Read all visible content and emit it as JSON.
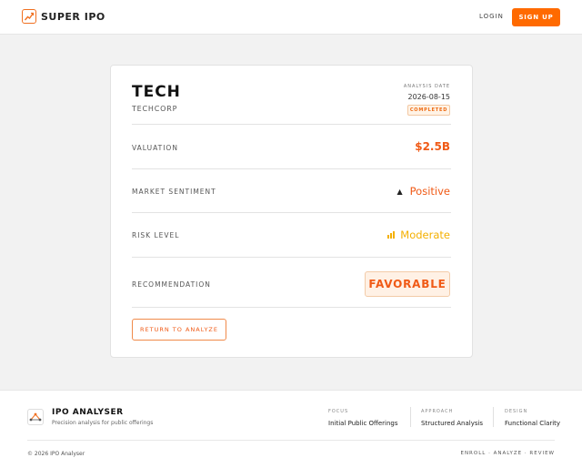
{
  "header": {
    "brand": "SUPER IPO",
    "login_label": "LOGIN",
    "signup_label": "SIGN UP"
  },
  "analysis": {
    "company": "TECH",
    "company_sub": "TECHCORP",
    "date_label": "ANALYSIS DATE",
    "date_value": "2026-08-15",
    "status": "COMPLETED",
    "rows": {
      "valuation": {
        "label": "VALUATION",
        "value": "$2.5B"
      },
      "sentiment": {
        "label": "MARKET SENTIMENT",
        "value": "Positive",
        "icon": "triangle-up-icon"
      },
      "risk": {
        "label": "RISK LEVEL",
        "value": "Moderate",
        "icon": "signal-bars-icon"
      },
      "recommendation": {
        "label": "RECOMMENDATION",
        "value": "FAVORABLE"
      }
    },
    "return_label": "RETURN TO ANALYZE"
  },
  "footer": {
    "title": "IPO ANALYSER",
    "subtitle": "Precision analysis for public offerings",
    "columns": [
      {
        "label": "FOCUS",
        "value": "Initial Public Offerings"
      },
      {
        "label": "APPROACH",
        "value": "Structured Analysis"
      },
      {
        "label": "DESIGN",
        "value": "Functional Clarity"
      }
    ],
    "copyright": "© 2026 IPO Analyser",
    "links": "ENROLL · ANALYZE · REVIEW"
  },
  "colors": {
    "accent": "#ff6a00",
    "positive": "#f05a16",
    "moderate": "#f4b000"
  }
}
